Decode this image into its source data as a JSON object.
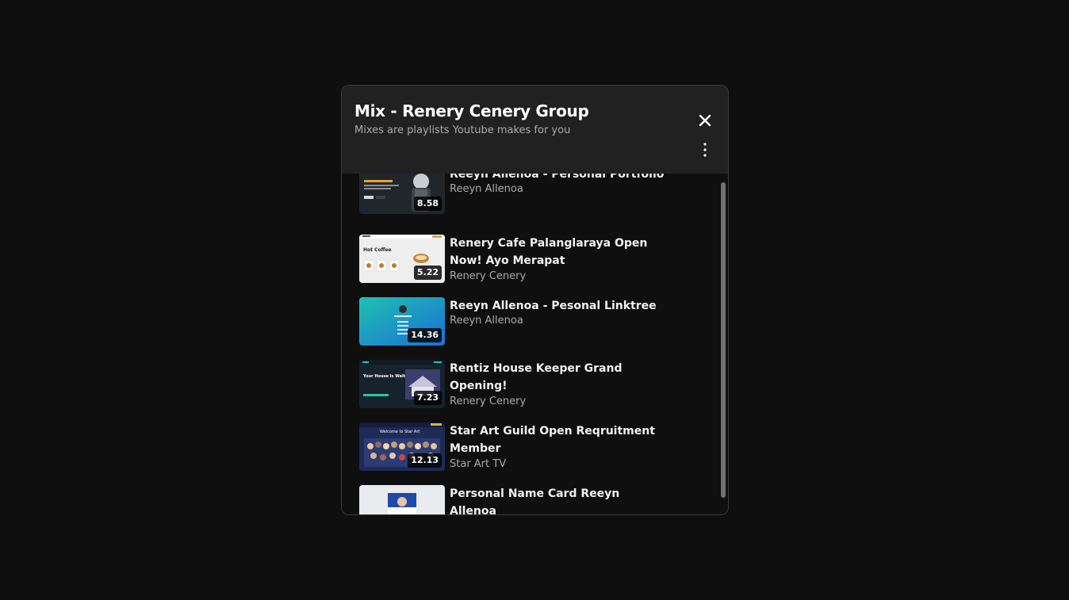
{
  "playlist": {
    "title": "Mix - Renery Cenery Group",
    "subtitle": "Mixes are playlists Youtube makes for you",
    "close_icon": "close-icon",
    "more_icon": "more-vert-icon"
  },
  "items": [
    {
      "title": "Reeyn Allenoa - Personal Portfolio",
      "channel": "Reeyn Allenoa",
      "duration": "8.58"
    },
    {
      "title": "Renery Cafe Palanglaraya Open Now! Ayo Merapat",
      "channel": "Renery Cenery",
      "duration": "5.22"
    },
    {
      "title": "Reeyn Allenoa - Pesonal Linktree",
      "channel": "Reeyn Allenoa",
      "duration": "14.36"
    },
    {
      "title": "Rentiz House Keeper Grand Opening!",
      "channel": "Renery Cenery",
      "duration": "7.23"
    },
    {
      "title": "Star Art Guild Open Reqruitment Member",
      "channel": "Star Art TV",
      "duration": "12.13"
    },
    {
      "title": "Personal Name Card Reeyn Allenoa",
      "channel": "",
      "duration": ""
    }
  ],
  "thumbnail_text": {
    "coffee": "Hot Coffee",
    "house": "Your House Is Waiting For You!",
    "guild": "Welcome to Star Art"
  }
}
